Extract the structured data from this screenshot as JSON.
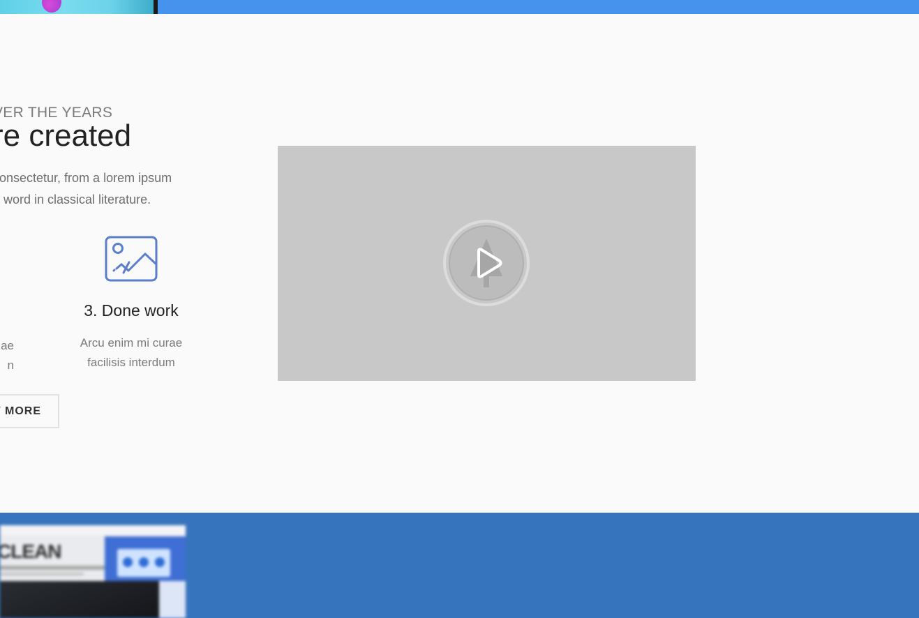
{
  "section": {
    "eyebrow": "VER THE YEARS",
    "heading": "re created",
    "description_lines": [
      "consectetur, from a lorem ipsum",
      "e word in classical literature."
    ],
    "previous_feature_lines": [
      "ae",
      "n"
    ],
    "feature": {
      "icon": "image-icon",
      "title": "3. Done work",
      "text_lines": [
        "Arcu enim mi curae",
        "facilisis interdum"
      ]
    },
    "more_button_label": "W MORE",
    "video": {
      "play_icon": "play-icon",
      "watermark_icon": "tree-icon"
    }
  },
  "colors": {
    "top_strip": "#4593ec",
    "section_bg": "#fafafa",
    "accent_icon": "#5b7ecb",
    "video_bg": "#c8c8c8",
    "bottom_band": "#3774be"
  },
  "bottom_band": {
    "thumbnail_title": "CLEAN"
  }
}
